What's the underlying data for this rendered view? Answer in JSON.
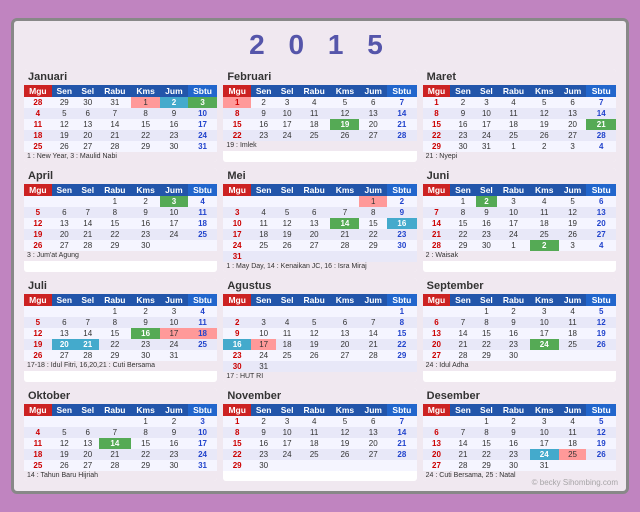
{
  "title": "2 0 1 5",
  "months": [
    {
      "name": "Januari",
      "headers": [
        "Mgu",
        "Sen",
        "Sel",
        "Rabu",
        "Kms",
        "Jum",
        "Sbtu"
      ],
      "rows": [
        [
          "28",
          "29",
          "30",
          "31",
          "1",
          "2",
          "3"
        ],
        [
          "4",
          "5",
          "6",
          "7",
          "8",
          "9",
          "10"
        ],
        [
          "11",
          "12",
          "13",
          "14",
          "15",
          "16",
          "17"
        ],
        [
          "18",
          "19",
          "20",
          "21",
          "22",
          "23",
          "24"
        ],
        [
          "25",
          "26",
          "27",
          "28",
          "29",
          "30",
          "31"
        ]
      ],
      "sundays": [
        28,
        4,
        11,
        18,
        25
      ],
      "saturdays": [
        3,
        10,
        17,
        24,
        31
      ],
      "holidays": {
        "1": "holiday",
        "2": "special2",
        "3": "special"
      },
      "notes": "1 : New Year,  3 : Maulid Nabi"
    },
    {
      "name": "Februari",
      "headers": [
        "Mgu",
        "Sen",
        "Sel",
        "Rabu",
        "Kms",
        "Jum",
        "Sbtu"
      ],
      "rows": [
        [
          "1",
          "2",
          "3",
          "4",
          "5",
          "6",
          "7"
        ],
        [
          "8",
          "9",
          "10",
          "11",
          "12",
          "13",
          "14"
        ],
        [
          "15",
          "16",
          "17",
          "18",
          "19",
          "20",
          "21"
        ],
        [
          "22",
          "23",
          "24",
          "25",
          "26",
          "27",
          "28"
        ]
      ],
      "sundays": [
        1,
        8,
        15,
        22
      ],
      "saturdays": [
        7,
        14,
        21,
        28
      ],
      "holidays": {
        "1": "holiday",
        "19": "special"
      },
      "notes": "19 : Imlek"
    },
    {
      "name": "Maret",
      "headers": [
        "Mgu",
        "Sen",
        "Sel",
        "Rabu",
        "Kms",
        "Jum",
        "Sbtu"
      ],
      "rows": [
        [
          "1",
          "2",
          "3",
          "4",
          "5",
          "6",
          "7"
        ],
        [
          "8",
          "9",
          "10",
          "11",
          "12",
          "13",
          "14"
        ],
        [
          "15",
          "16",
          "17",
          "18",
          "19",
          "20",
          "21"
        ],
        [
          "22",
          "23",
          "24",
          "25",
          "26",
          "27",
          "28"
        ],
        [
          "29",
          "30",
          "31",
          "1",
          "2",
          "3",
          "4"
        ]
      ],
      "sundays": [
        1,
        8,
        15,
        22,
        29
      ],
      "saturdays": [
        7,
        14,
        21,
        28
      ],
      "holidays": {
        "21": "special"
      },
      "notes": "21 : Nyepi"
    },
    {
      "name": "April",
      "headers": [
        "Mgu",
        "Sen",
        "Sel",
        "Rabu",
        "Kms",
        "Jum",
        "Sbtu"
      ],
      "rows": [
        [
          "",
          "",
          "",
          "1",
          "2",
          "3",
          "4"
        ],
        [
          "5",
          "6",
          "7",
          "8",
          "9",
          "10",
          "11"
        ],
        [
          "12",
          "13",
          "14",
          "15",
          "16",
          "17",
          "18"
        ],
        [
          "19",
          "20",
          "21",
          "22",
          "23",
          "24",
          "25"
        ],
        [
          "26",
          "27",
          "28",
          "29",
          "30",
          "",
          ""
        ]
      ],
      "sundays": [
        5,
        12,
        19,
        26
      ],
      "saturdays": [
        4,
        11,
        18,
        25
      ],
      "holidays": {
        "3": "special"
      },
      "notes": "3 : Jum'at Agung"
    },
    {
      "name": "Mei",
      "headers": [
        "Mgu",
        "Sen",
        "Sel",
        "Rabu",
        "Kms",
        "Jum",
        "Sbtu"
      ],
      "rows": [
        [
          "",
          "",
          "",
          "",
          "",
          "1",
          "2"
        ],
        [
          "3",
          "4",
          "5",
          "6",
          "7",
          "8",
          "9"
        ],
        [
          "10",
          "11",
          "12",
          "13",
          "14",
          "15",
          "16"
        ],
        [
          "17",
          "18",
          "19",
          "20",
          "21",
          "22",
          "23"
        ],
        [
          "24",
          "25",
          "26",
          "27",
          "28",
          "29",
          "30"
        ],
        [
          "31",
          "",
          "",
          "",
          "",
          "",
          ""
        ]
      ],
      "sundays": [
        3,
        10,
        17,
        24,
        31
      ],
      "saturdays": [
        2,
        9,
        16,
        23,
        30
      ],
      "holidays": {
        "1": "holiday",
        "14": "special",
        "16": "special2"
      },
      "notes": "1 : May Day, 14 : Kenaikan JC, 16 : Isra Miraj"
    },
    {
      "name": "Juni",
      "headers": [
        "Mgu",
        "Sen",
        "Sel",
        "Rabu",
        "Kms",
        "Jum",
        "Sbtu"
      ],
      "rows": [
        [
          "",
          "1",
          "2",
          "3",
          "4",
          "5",
          "6"
        ],
        [
          "7",
          "8",
          "9",
          "10",
          "11",
          "12",
          "13"
        ],
        [
          "14",
          "15",
          "16",
          "17",
          "18",
          "19",
          "20"
        ],
        [
          "21",
          "22",
          "23",
          "24",
          "25",
          "26",
          "27"
        ],
        [
          "28",
          "29",
          "30",
          "1",
          "2",
          "3",
          "4"
        ]
      ],
      "sundays": [
        7,
        14,
        21,
        28
      ],
      "saturdays": [
        6,
        13,
        20,
        27
      ],
      "holidays": {
        "2": "special"
      },
      "notes": "2 : Waisak"
    },
    {
      "name": "Juli",
      "headers": [
        "Mgu",
        "Sen",
        "Sel",
        "Rabu",
        "Kms",
        "Jum",
        "Sbtu"
      ],
      "rows": [
        [
          "",
          "",
          "",
          "1",
          "2",
          "3",
          "4"
        ],
        [
          "5",
          "6",
          "7",
          "8",
          "9",
          "10",
          "11"
        ],
        [
          "12",
          "13",
          "14",
          "15",
          "16",
          "17",
          "18"
        ],
        [
          "19",
          "20",
          "21",
          "22",
          "23",
          "24",
          "25"
        ],
        [
          "26",
          "27",
          "28",
          "29",
          "30",
          "31",
          ""
        ]
      ],
      "sundays": [
        5,
        12,
        19,
        26
      ],
      "saturdays": [
        4,
        11,
        18,
        25
      ],
      "holidays": {
        "17": "holiday",
        "18": "holiday",
        "16": "special",
        "20": "special2",
        "21": "special2"
      },
      "notes": "17-18 : Idul Fitri, 16,20,21 : Cuti Bersama"
    },
    {
      "name": "Agustus",
      "headers": [
        "Mgu",
        "Sen",
        "Sel",
        "Rabu",
        "Kms",
        "Jum",
        "Sbtu"
      ],
      "rows": [
        [
          "",
          "",
          "",
          "",
          "",
          "",
          "1"
        ],
        [
          "2",
          "3",
          "4",
          "5",
          "6",
          "7",
          "8"
        ],
        [
          "9",
          "10",
          "11",
          "12",
          "13",
          "14",
          "15"
        ],
        [
          "16",
          "17",
          "18",
          "19",
          "20",
          "21",
          "22"
        ],
        [
          "23",
          "24",
          "25",
          "26",
          "27",
          "28",
          "29"
        ],
        [
          "30",
          "31",
          "",
          "",
          "",
          "",
          ""
        ]
      ],
      "sundays": [
        2,
        9,
        16,
        23,
        30
      ],
      "saturdays": [
        1,
        8,
        15,
        22,
        29
      ],
      "holidays": {
        "17": "holiday",
        "16": "special2"
      },
      "notes": "17 : HUT RI"
    },
    {
      "name": "September",
      "headers": [
        "Mgu",
        "Sen",
        "Sel",
        "Rabu",
        "Kms",
        "Jum",
        "Sbtu"
      ],
      "rows": [
        [
          "",
          "",
          "1",
          "2",
          "3",
          "4",
          "5"
        ],
        [
          "6",
          "7",
          "8",
          "9",
          "10",
          "11",
          "12"
        ],
        [
          "13",
          "14",
          "15",
          "16",
          "17",
          "18",
          "19"
        ],
        [
          "20",
          "21",
          "22",
          "23",
          "24",
          "25",
          "26"
        ],
        [
          "27",
          "28",
          "29",
          "30",
          "",
          "",
          ""
        ]
      ],
      "sundays": [
        6,
        13,
        20,
        27
      ],
      "saturdays": [
        5,
        12,
        19,
        26
      ],
      "holidays": {
        "24": "special"
      },
      "notes": "24 : Idul Adha"
    },
    {
      "name": "Oktober",
      "headers": [
        "Mgu",
        "Sen",
        "Sel",
        "Rabu",
        "Kms",
        "Jum",
        "Sbtu"
      ],
      "rows": [
        [
          "",
          "",
          "",
          "",
          "1",
          "2",
          "3"
        ],
        [
          "4",
          "5",
          "6",
          "7",
          "8",
          "9",
          "10"
        ],
        [
          "11",
          "12",
          "13",
          "14",
          "15",
          "16",
          "17"
        ],
        [
          "18",
          "19",
          "20",
          "21",
          "22",
          "23",
          "24"
        ],
        [
          "25",
          "26",
          "27",
          "28",
          "29",
          "30",
          "31"
        ]
      ],
      "sundays": [
        4,
        11,
        18,
        25
      ],
      "saturdays": [
        3,
        10,
        17,
        24,
        31
      ],
      "holidays": {
        "14": "special"
      },
      "notes": "14 : Tahun Baru Hijriah"
    },
    {
      "name": "November",
      "headers": [
        "Mgu",
        "Sen",
        "Sel",
        "Rabu",
        "Kms",
        "Jum",
        "Sbtu"
      ],
      "rows": [
        [
          "1",
          "2",
          "3",
          "4",
          "5",
          "6",
          "7"
        ],
        [
          "8",
          "9",
          "10",
          "11",
          "12",
          "13",
          "14"
        ],
        [
          "15",
          "16",
          "17",
          "18",
          "19",
          "20",
          "21"
        ],
        [
          "22",
          "23",
          "24",
          "25",
          "26",
          "27",
          "28"
        ],
        [
          "29",
          "30",
          "",
          "",
          "",
          "",
          ""
        ]
      ],
      "sundays": [
        1,
        8,
        15,
        22,
        29
      ],
      "saturdays": [
        7,
        14,
        21,
        28
      ],
      "holidays": {},
      "notes": ""
    },
    {
      "name": "Desember",
      "headers": [
        "Mgu",
        "Sen",
        "Sel",
        "Rabu",
        "Kms",
        "Jum",
        "Sbtu"
      ],
      "rows": [
        [
          "",
          "",
          "1",
          "2",
          "3",
          "4",
          "5"
        ],
        [
          "6",
          "7",
          "8",
          "9",
          "10",
          "11",
          "12"
        ],
        [
          "13",
          "14",
          "15",
          "16",
          "17",
          "18",
          "19"
        ],
        [
          "20",
          "21",
          "22",
          "23",
          "24",
          "25",
          "26"
        ],
        [
          "27",
          "28",
          "29",
          "30",
          "31",
          "",
          ""
        ]
      ],
      "sundays": [
        6,
        13,
        20,
        27
      ],
      "saturdays": [
        5,
        12,
        19,
        26
      ],
      "holidays": {
        "24": "special2",
        "25": "holiday"
      },
      "notes": "24 : Cuti Bersama, 25 : Natal"
    }
  ],
  "watermark": "© becky Sihombing.com"
}
